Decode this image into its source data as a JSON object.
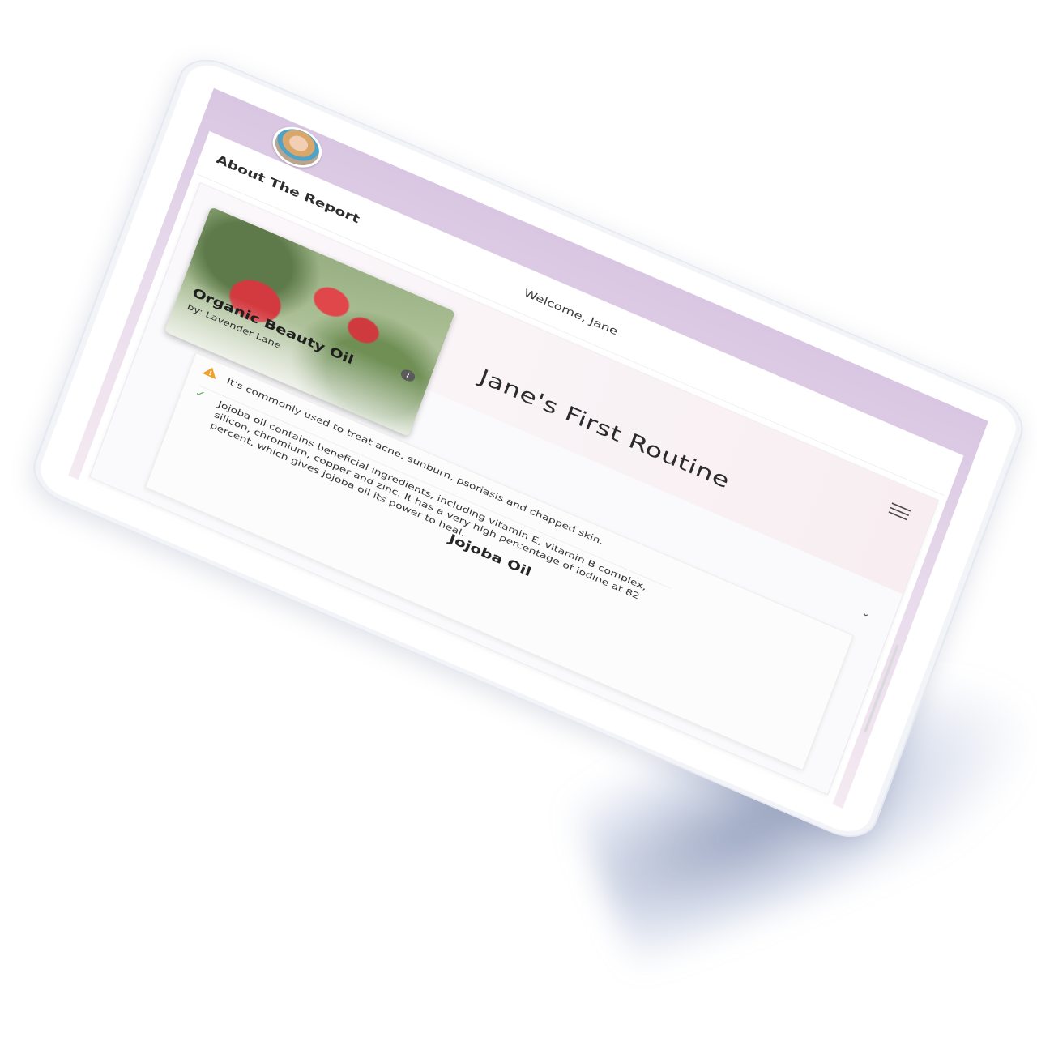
{
  "header": {
    "welcome_text": "Welcome, Jane",
    "avatar_label": "avatar"
  },
  "report": {
    "title": "About The Report"
  },
  "routine": {
    "title": "Jane's First Routine",
    "menu_icon": "hamburger-menu-icon",
    "expand_icon": "chevron-down-icon"
  },
  "product": {
    "name": "Organic Beauty Oil",
    "by": "by: Lavender Lane",
    "info_icon": "info-icon",
    "info_glyph": "i"
  },
  "ingredient": {
    "title": "Jojoba Oil",
    "warning_note": "It's commonly used to treat acne, sunburn, psoriasis and chapped skin.",
    "benefit_note": "Jojoba oil contains beneficial ingredients, including vitamin E, vitamin B complex, silicon, chromium, copper and zinc. It has a very high percentage of iodine at 82 percent, which gives jojoba oil its power to heal."
  },
  "colors": {
    "screen_gradient_top": "#d9c6e2",
    "warning": "#f0a12a",
    "check": "#6aa56a"
  }
}
